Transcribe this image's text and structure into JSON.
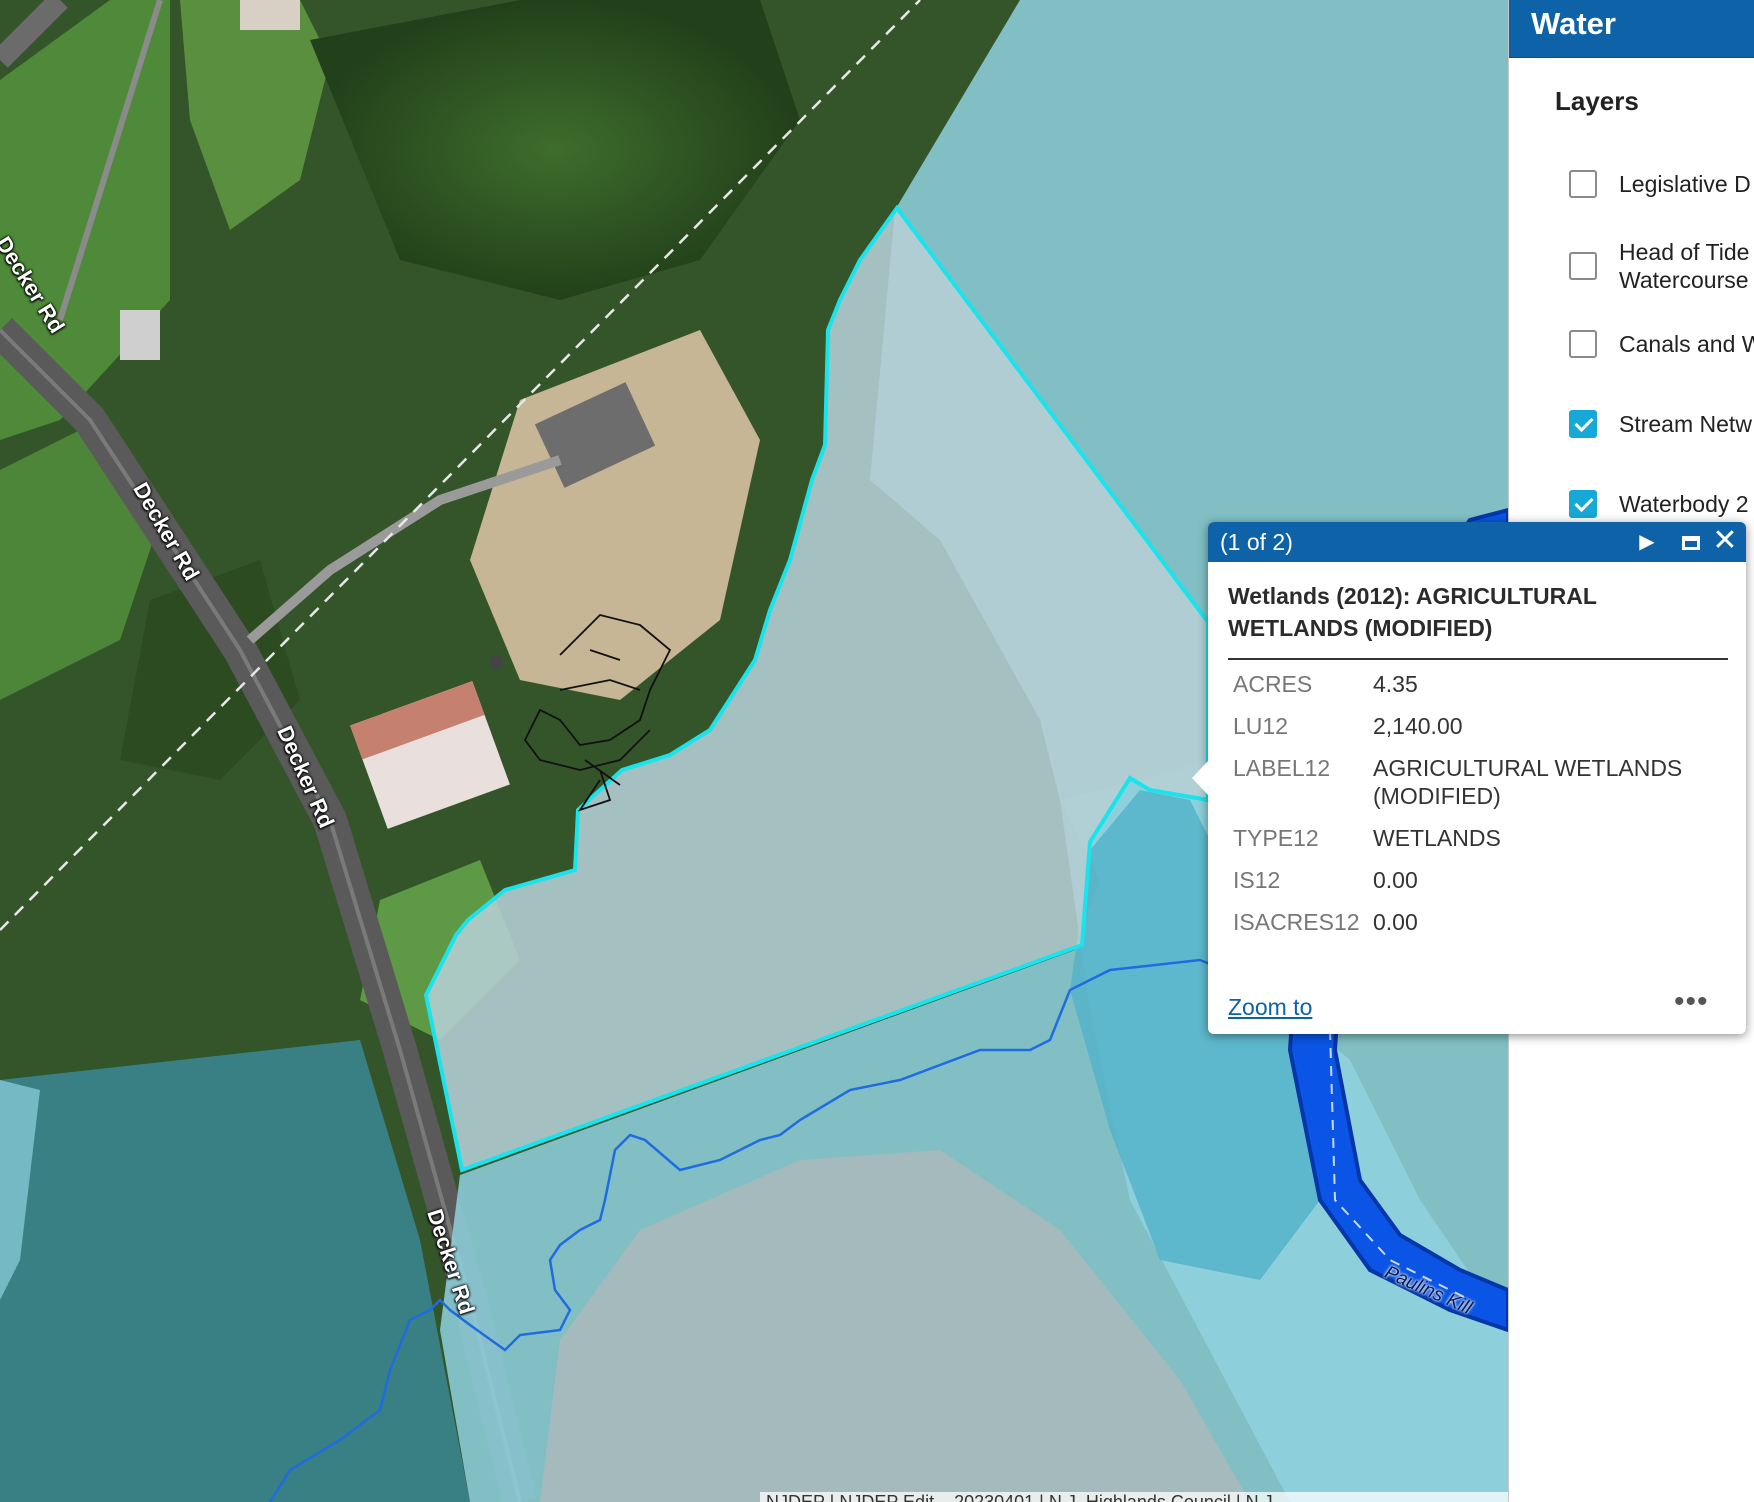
{
  "map": {
    "road_label": "Decker Rd",
    "river_label": "Paulins Kill",
    "attribution": "NJDEP | NJDEP Edit... 20230401 | N.J. Highlands Council | N.J."
  },
  "panel": {
    "title": "Water",
    "layers_heading": "Layers",
    "layers": [
      {
        "label": "Legislative D",
        "checked": false
      },
      {
        "label": "Head of Tide",
        "label2": "Watercourse",
        "checked": false
      },
      {
        "label": "Canals and W",
        "checked": false
      },
      {
        "label": "Stream Netw",
        "checked": true
      },
      {
        "label": "Waterbody 2",
        "checked": true
      }
    ]
  },
  "popup": {
    "counter": "(1 of 2)",
    "next_icon": "▶",
    "close_icon": "✕",
    "title": "Wetlands (2012): AGRICULTURAL WETLANDS (MODIFIED)",
    "attributes": [
      {
        "key": "ACRES",
        "value": "4.35"
      },
      {
        "key": "LU12",
        "value": "2,140.00"
      },
      {
        "key": "LABEL12",
        "value": "AGRICULTURAL WETLANDS (MODIFIED)"
      },
      {
        "key": "TYPE12",
        "value": "WETLANDS"
      },
      {
        "key": "IS12",
        "value": "0.00"
      },
      {
        "key": "ISACRES12",
        "value": "0.00"
      }
    ],
    "zoom_label": "Zoom to",
    "more_label": "•••"
  },
  "colors": {
    "accent": "#0d62a8",
    "checkbox_checked": "#16a8d6",
    "selection_outline": "#19e3ec",
    "stream_line": "#1f6be0",
    "river_fill": "#0a55e6"
  }
}
